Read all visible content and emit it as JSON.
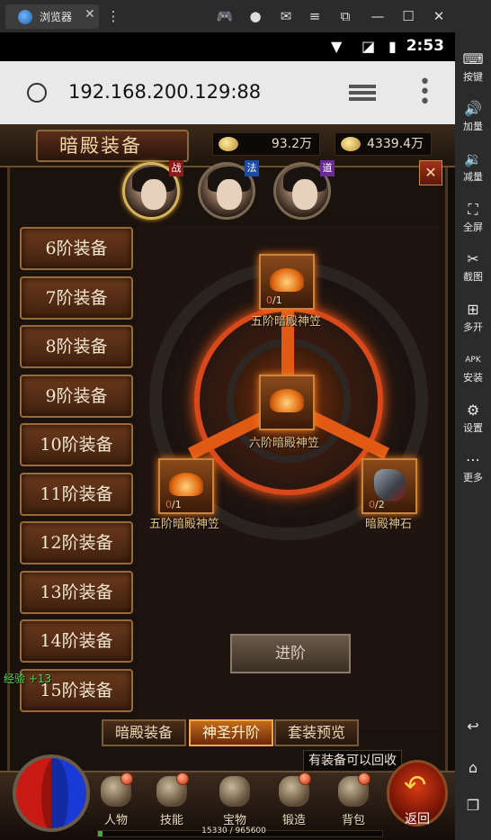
{
  "emulator": {
    "tab_title": "浏览器",
    "tab_close": "✕",
    "top_icons": [
      "gamepad-icon",
      "account-icon",
      "mail-icon",
      "menu-icon",
      "screenshot-crop-icon",
      "minimize-icon",
      "maximize-icon",
      "close-icon",
      "collapse-icon"
    ],
    "sidebar": [
      {
        "icon": "keyboard-icon",
        "label": "按键"
      },
      {
        "icon": "volume-up-icon",
        "label": "加量"
      },
      {
        "icon": "volume-down-icon",
        "label": "减量"
      },
      {
        "icon": "fullscreen-icon",
        "label": "全屏"
      },
      {
        "icon": "scissors-icon",
        "label": "截图"
      },
      {
        "icon": "multi-open-icon",
        "label": "多开"
      },
      {
        "icon": "apk-icon",
        "label": "安装"
      },
      {
        "icon": "settings-icon",
        "label": "设置"
      },
      {
        "icon": "more-icon",
        "label": "更多"
      }
    ]
  },
  "status_bar": {
    "time": "2:53"
  },
  "browser": {
    "url": "192.168.200.129:88"
  },
  "game": {
    "title": "暗殿装备",
    "resources": [
      {
        "icon": "coin-icon",
        "value": "93.2万"
      },
      {
        "icon": "gold-ingot-icon",
        "value": "4339.4万"
      }
    ],
    "characters": [
      {
        "name": "warrior",
        "class_badge": "战",
        "selected": true
      },
      {
        "name": "mage",
        "class_badge": "法",
        "selected": false
      },
      {
        "name": "taoist",
        "class_badge": "道",
        "selected": false
      }
    ],
    "tiers": [
      "6阶装备",
      "7阶装备",
      "8阶装备",
      "9阶装备",
      "10阶装备",
      "11阶装备",
      "12阶装备",
      "13阶装备",
      "14阶装备",
      "15阶装备"
    ],
    "composite": {
      "top": {
        "label": "五阶暗殿神笠",
        "have": "0",
        "need": "/1"
      },
      "center": {
        "label": "六阶暗殿神笠"
      },
      "left": {
        "label": "五阶暗殿神笠",
        "have": "0",
        "need": "/1"
      },
      "right": {
        "label": "暗殿神石",
        "have": "0",
        "need": "/2"
      }
    },
    "advance_label": "进阶",
    "exp_gain": "经验 +13",
    "bottom_tabs": [
      {
        "label": "暗殿装备",
        "active": false
      },
      {
        "label": "神圣升阶",
        "active": true
      },
      {
        "label": "套装预览",
        "active": false
      }
    ],
    "tooltip": "有装备可以回收",
    "hud_buttons": [
      "人物",
      "技能",
      "宝物",
      "锻造",
      "背包"
    ],
    "return_label": "返回",
    "xp_text": "15330 / 965600",
    "xp_fraction": 0.016
  }
}
